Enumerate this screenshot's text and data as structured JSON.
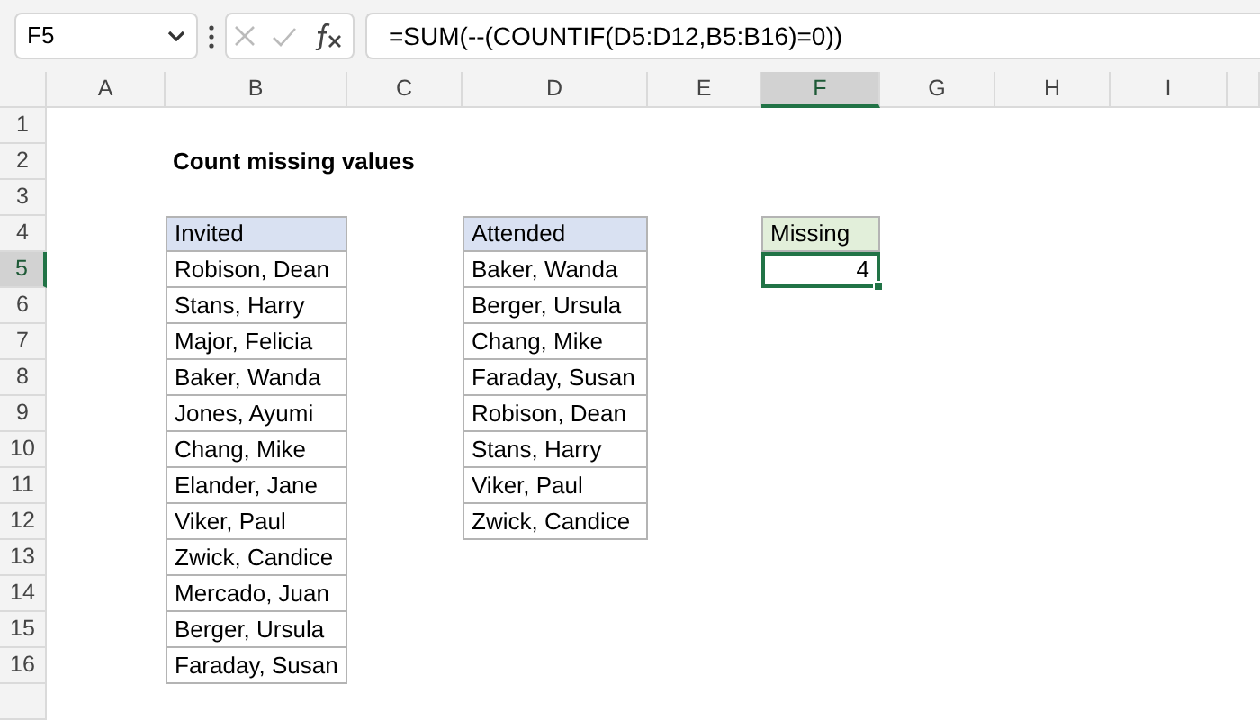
{
  "name_box": {
    "value": "F5"
  },
  "formula_bar": {
    "formula": "=SUM(--(COUNTIF(D5:D12,B5:B16)=0))"
  },
  "columns": [
    {
      "label": "A",
      "selected": false
    },
    {
      "label": "B",
      "selected": false
    },
    {
      "label": "C",
      "selected": false
    },
    {
      "label": "D",
      "selected": false
    },
    {
      "label": "E",
      "selected": false
    },
    {
      "label": "F",
      "selected": true
    },
    {
      "label": "G",
      "selected": false
    },
    {
      "label": "H",
      "selected": false
    },
    {
      "label": "I",
      "selected": false
    }
  ],
  "rows": [
    {
      "label": "1",
      "selected": false
    },
    {
      "label": "2",
      "selected": false
    },
    {
      "label": "3",
      "selected": false
    },
    {
      "label": "4",
      "selected": false
    },
    {
      "label": "5",
      "selected": true
    },
    {
      "label": "6",
      "selected": false
    },
    {
      "label": "7",
      "selected": false
    },
    {
      "label": "8",
      "selected": false
    },
    {
      "label": "9",
      "selected": false
    },
    {
      "label": "10",
      "selected": false
    },
    {
      "label": "11",
      "selected": false
    },
    {
      "label": "12",
      "selected": false
    },
    {
      "label": "13",
      "selected": false
    },
    {
      "label": "14",
      "selected": false
    },
    {
      "label": "15",
      "selected": false
    },
    {
      "label": "16",
      "selected": false
    }
  ],
  "title": "Count missing values",
  "lists": [
    {
      "header": "Invited",
      "items": [
        "Robison, Dean",
        "Stans, Harry",
        "Major, Felicia",
        "Baker, Wanda",
        "Jones, Ayumi",
        "Chang, Mike",
        "Elander, Jane",
        "Viker, Paul",
        "Zwick, Candice",
        "Mercado, Juan",
        "Berger, Ursula",
        "Faraday, Susan"
      ]
    },
    {
      "header": "Attended",
      "items": [
        "Baker, Wanda",
        "Berger, Ursula",
        "Chang, Mike",
        "Faraday, Susan",
        "Robison, Dean",
        "Stans, Harry",
        "Viker, Paul",
        "Zwick, Candice"
      ]
    }
  ],
  "result": {
    "header": "Missing",
    "value": "4",
    "selected": true
  }
}
